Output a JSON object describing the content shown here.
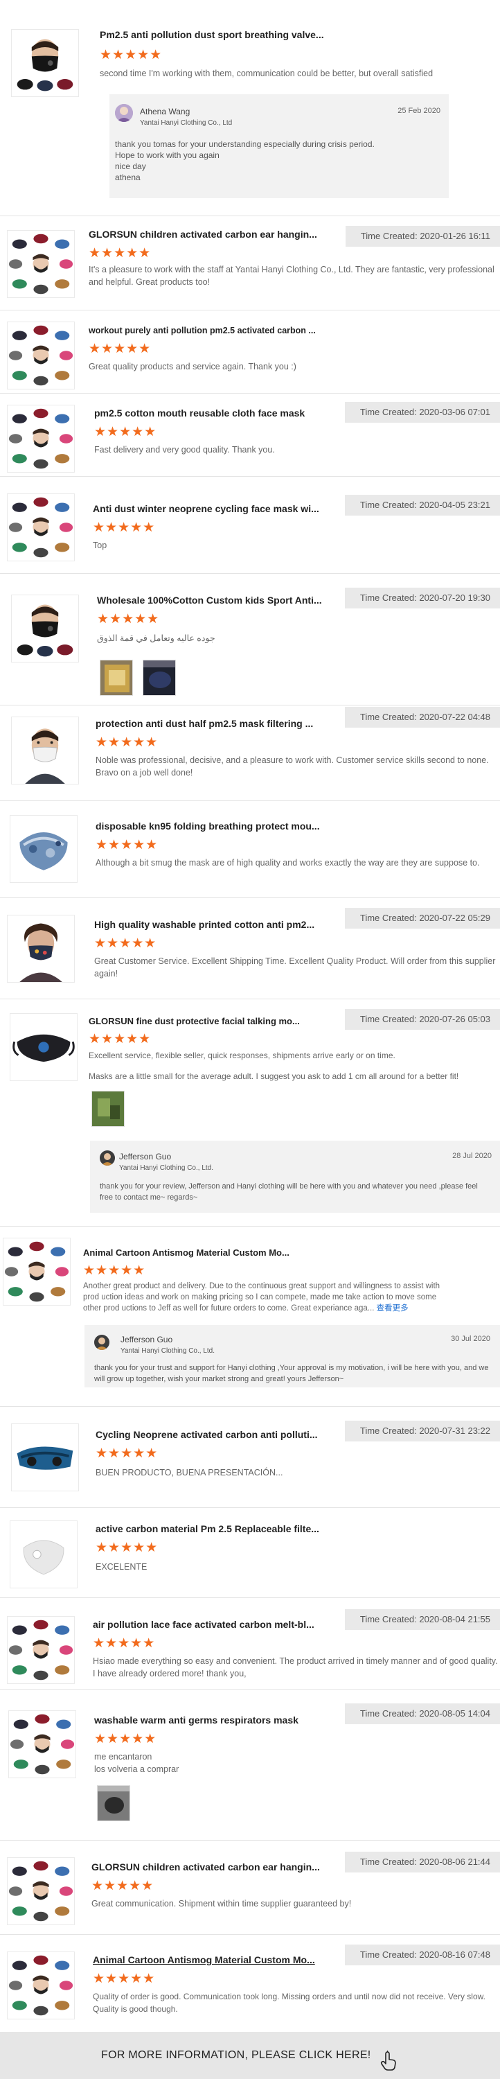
{
  "reviews": [
    {
      "title": "Pm2.5 anti pollution dust sport breathing valve...",
      "time_label": "",
      "stars": "★★★★★",
      "text": "second time I'm working with them, communication could be better, but overall satisfied",
      "reply": {
        "name": "Athena Wang",
        "company": "Yantai Hanyi Clothing Co., Ltd",
        "date": "25 Feb 2020",
        "text": "thank you tomas for your understanding especially during crisis period.\nHope to work with you again\nnice day\nathena"
      }
    },
    {
      "title": "GLORSUN children activated carbon ear hangin...",
      "time_label": "Time Created: 2020-01-26 16:11",
      "stars": "★★★★★",
      "text": "It's a pleasure to work with the staff at Yantai Hanyi Clothing Co., Ltd. They are fantastic, very professional and helpful. Great products too!"
    },
    {
      "title": "workout purely anti pollution pm2.5 activated carbon ...",
      "time_label": "",
      "stars": "★★★★★",
      "text": "Great quality products and service again. Thank you :)"
    },
    {
      "title": "pm2.5 cotton mouth reusable cloth face mask",
      "time_label": "Time Created: 2020-03-06 07:01",
      "stars": "★★★★★",
      "text": "Fast delivery and very good quality. Thank you."
    },
    {
      "title": "Anti dust winter neoprene cycling face mask wi...",
      "time_label": "Time Created: 2020-04-05 23:21",
      "stars": "★★★★★",
      "text": "Top"
    },
    {
      "title": "Wholesale 100%Cotton Custom kids Sport Anti...",
      "time_label": "Time Created: 2020-07-20 19:30",
      "stars": "★★★★★",
      "text": "جوده عاليه وتعامل في قمة الذوق"
    },
    {
      "title": "protection anti dust half pm2.5 mask filtering ...",
      "time_label": "Time Created: 2020-07-22 04:48",
      "stars": "★★★★★",
      "text": "Noble was professional, decisive, and a pleasure to work with.  Customer service skills second to none. Bravo on a job well done!"
    },
    {
      "title": "disposable kn95 folding breathing protect mou...",
      "time_label": "",
      "stars": "★★★★★",
      "text": "Although a bit smug the mask are of high quality and works exactly the way are they are suppose to."
    },
    {
      "title": "High quality washable printed cotton anti pm2...",
      "time_label": "Time Created: 2020-07-22 05:29",
      "stars": "★★★★★",
      "text": "Great Customer Service.  Excellent Shipping Time.  Excellent Quality Product.  Will order from this supplier again!"
    },
    {
      "title": "GLORSUN fine dust protective facial talking mo...",
      "time_label": "Time Created: 2020-07-26 05:03",
      "stars": "★★★★★",
      "text": "Excellent service, flexible seller, quick responses, shipments arrive early or on time.",
      "text2": "Masks are a little small for the average adult. I suggest you ask to add 1 cm all around for a better fit!",
      "reply": {
        "name": "Jefferson Guo",
        "company": "Yantai Hanyi Clothing Co., Ltd.",
        "date": "28 Jul 2020",
        "text": "thank you for your review, Jefferson and Hanyi clothing will be here with you and whatever you need ,please feel free to contact me~ regards~"
      }
    },
    {
      "title": "Animal Cartoon Antismog Material Custom Mo...",
      "time_label": "",
      "stars": "★★★★★",
      "text": "Another great product and delivery. Due to the continuous great support and willingness to assist with prod uction ideas and work on making pricing so I can compete, made me take action to move some other prod uctions to Jeff as well for future orders to come. Great experiance aga...",
      "more": "查看更多",
      "reply": {
        "name": "Jefferson Guo",
        "company": "Yantai Hanyi Clothing Co., Ltd.",
        "date": "30 Jul 2020",
        "text": "thank you for your trust and support for Hanyi clothing ,Your approval is my motivation,  i will be here with you, and we will grow up together, wish your market strong and great! yours Jefferson~"
      }
    },
    {
      "title": "Cycling Neoprene activated carbon anti polluti...",
      "time_label": "Time Created: 2020-07-31 23:22",
      "stars": "★★★★★",
      "text": "BUEN PRODUCTO, BUENA PRESENTACIÓN..."
    },
    {
      "title": "active carbon material Pm 2.5 Replaceable filte...",
      "time_label": "",
      "stars": "★★★★★",
      "text": "EXCELENTE"
    },
    {
      "title": "air pollution lace face activated carbon melt-bl...",
      "time_label": "Time Created: 2020-08-04 21:55",
      "stars": "★★★★★",
      "text": "Hsiao made everything so easy and convenient.  The product arrived in timely manner and of good quality. I have already ordered more!  thank you,"
    },
    {
      "title": "washable warm anti germs respirators mask",
      "time_label": "Time Created: 2020-08-05 14:04",
      "stars": "★★★★★",
      "text": "me encantaron\nlos volveria a comprar"
    },
    {
      "title": "GLORSUN children activated carbon ear hangin...",
      "time_label": "Time Created: 2020-08-06 21:44",
      "stars": "★★★★★",
      "text": "Great communication. Shipment within time supplier guaranteed by!"
    },
    {
      "title": "Animal Cartoon Antismog Material Custom Mo...",
      "time_label": "Time Created: 2020-08-16 07:48",
      "stars": "★★★★★",
      "text": "Quality of order is good. Communication took long. Missing orders and until now did not receive. Very slow.\nQuality is good though."
    }
  ],
  "footer": {
    "label": "FOR MORE INFORMATION, PLEASE CLICK HERE!"
  },
  "colors": {
    "star": "#f26b1d",
    "time_bg": "#e9e9e9",
    "reply_bg": "#f2f2f2",
    "footer_bg": "#e6e6e6",
    "link": "#1f6fd1"
  }
}
